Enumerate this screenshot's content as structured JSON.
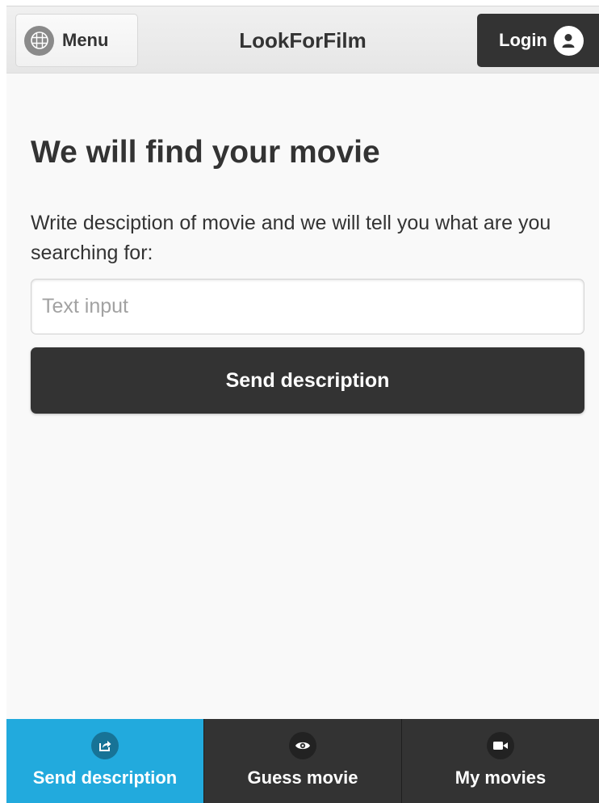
{
  "header": {
    "menu_label": "Menu",
    "menu_icon": "grid-icon",
    "title": "LookForFilm",
    "login_label": "Login",
    "login_icon": "user-icon"
  },
  "main": {
    "heading": "We will find your movie",
    "description": "Write desciption of movie and we will tell you what are you searching for:",
    "input": {
      "placeholder": "Text input",
      "value": ""
    },
    "submit_label": "Send description"
  },
  "footer_nav": {
    "items": [
      {
        "label": "Send description",
        "icon": "share-icon",
        "active": true
      },
      {
        "label": "Guess movie",
        "icon": "eye-icon",
        "active": false
      },
      {
        "label": "My movies",
        "icon": "video-camera-icon",
        "active": false
      }
    ]
  },
  "colors": {
    "accent": "#22aadd",
    "dark": "#333333",
    "background": "#f9f9f9"
  }
}
